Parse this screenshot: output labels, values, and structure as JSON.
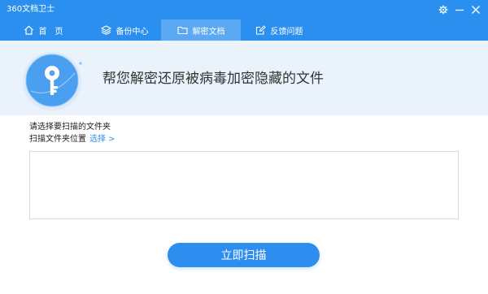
{
  "window": {
    "title": "360文档卫士",
    "controls": [
      "gear-icon",
      "minimize-icon",
      "close-icon"
    ]
  },
  "tabs": [
    {
      "label": "首　页",
      "icon": "home-icon",
      "active": false
    },
    {
      "label": "备份中心",
      "icon": "layers-icon",
      "active": false
    },
    {
      "label": "解密文档",
      "icon": "folder-icon",
      "active": true
    },
    {
      "label": "反馈问题",
      "icon": "edit-icon",
      "active": false
    }
  ],
  "hero": {
    "title": "帮您解密还原被病毒加密隐藏的文件",
    "icon": "key-icon"
  },
  "form": {
    "instruction": "请选择要扫描的文件夹",
    "location_label": "扫描文件夹位置",
    "choose_link": "选择 >"
  },
  "actions": {
    "scan_button": "立即扫描"
  },
  "colors": {
    "brand_blue": "#2b8ff0",
    "active_tab": "#5ba9f2",
    "hero_bg": "#eaf3fc"
  }
}
